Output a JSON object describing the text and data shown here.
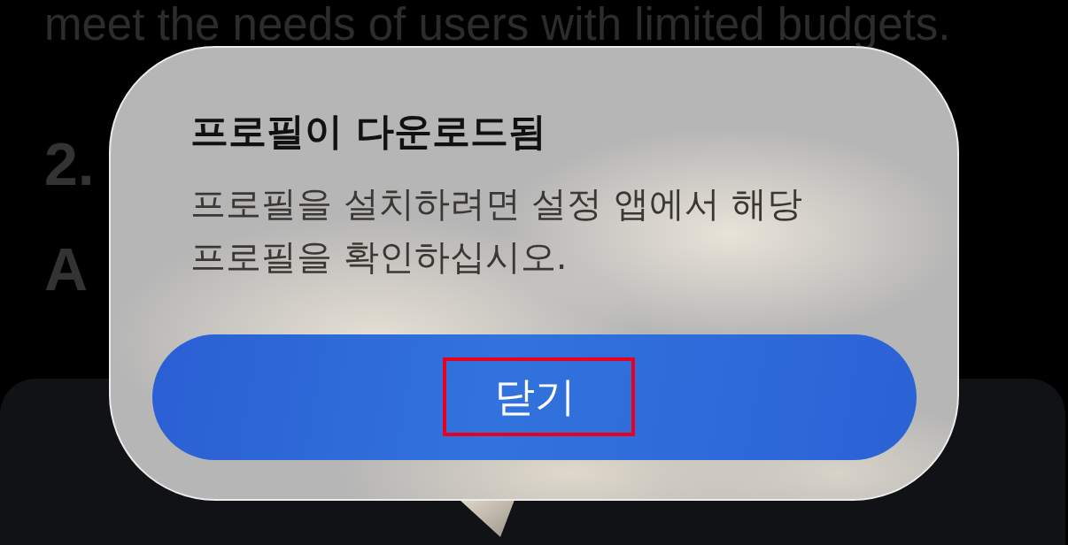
{
  "background": {
    "paragraph_end": "meet the needs of users with limited budgets.",
    "heading_number": "2.",
    "heading_start": "A"
  },
  "alert": {
    "title": "프로필이 다운로드됨",
    "message": "프로필을 설치하려면 설정 앱에서 해당 프로필을 확인하십시오.",
    "buttons": [
      {
        "label": "닫기",
        "highlighted": true
      }
    ]
  }
}
